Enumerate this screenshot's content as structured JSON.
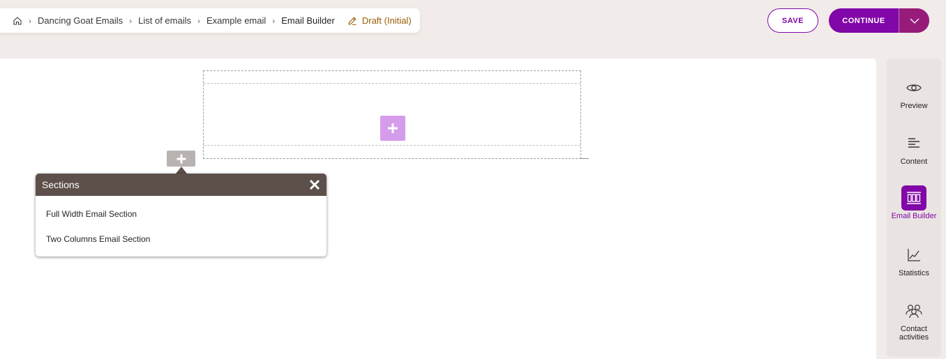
{
  "breadcrumb": {
    "items": [
      "Dancing Goat Emails",
      "List of emails",
      "Example email",
      "Email Builder"
    ],
    "status": "Draft (Initial)"
  },
  "header": {
    "save_label": "SAVE",
    "continue_label": "CONTINUE"
  },
  "sections_popup": {
    "title": "Sections",
    "items": [
      "Full Width Email Section",
      "Two Columns Email Section"
    ]
  },
  "sidebar": {
    "items": [
      {
        "label": "Preview",
        "icon": "eye-icon",
        "active": false
      },
      {
        "label": "Content",
        "icon": "content-lines-icon",
        "active": false
      },
      {
        "label": "Email Builder",
        "icon": "email-builder-icon",
        "active": true
      },
      {
        "label": "Statistics",
        "icon": "chart-icon",
        "active": false
      },
      {
        "label": "Contact activities",
        "icon": "contacts-icon",
        "active": false
      }
    ]
  },
  "colors": {
    "accent": "#8107a8",
    "background": "#f1ece9",
    "popup_header": "#5d4f4a",
    "add_widget": "#d59cec",
    "draft_status": "#9a5d00"
  }
}
